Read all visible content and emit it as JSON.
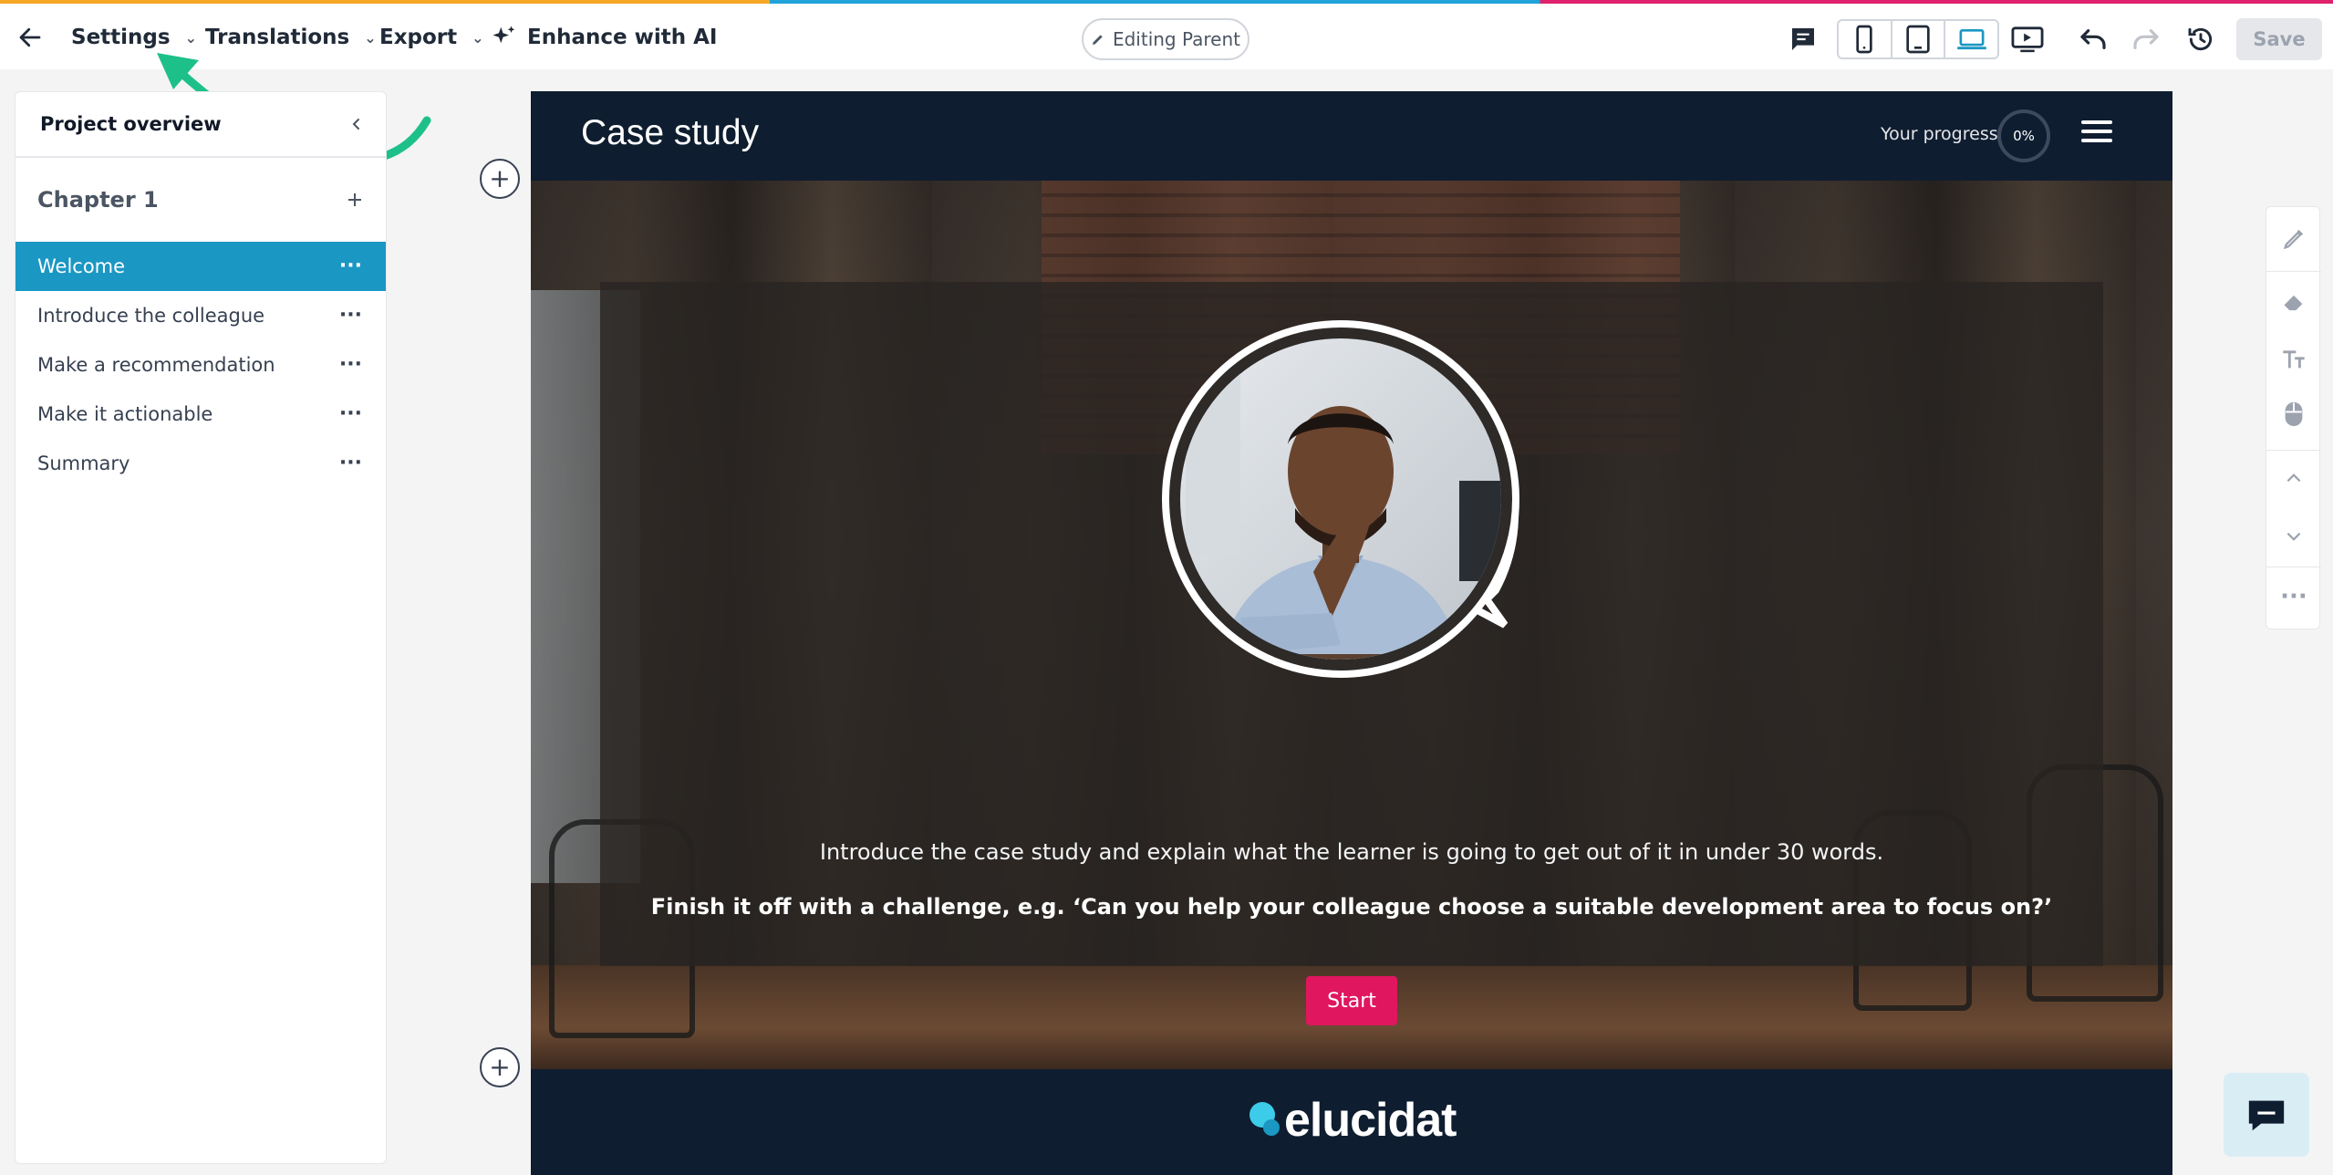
{
  "colors": {
    "accent": "#1b97c3",
    "start_button": "#e0165f",
    "header_bg": "#0f1d30",
    "annotation_arrow": "#1ec08a",
    "save_disabled": "#e5e7eb"
  },
  "toolbar": {
    "back_icon": "arrow-left-icon",
    "menus": [
      {
        "label": "Settings"
      },
      {
        "label": "Translations"
      },
      {
        "label": "Export"
      }
    ],
    "enhance_label": "Enhance with AI",
    "editing_label": "Editing Parent",
    "save_label": "Save",
    "icons": [
      "comment-icon",
      "phone-icon",
      "tablet-icon",
      "laptop-icon",
      "preview-icon",
      "undo-icon",
      "redo-icon",
      "history-icon"
    ],
    "active_device": "laptop"
  },
  "sidebar": {
    "title": "Project overview",
    "chapter": "Chapter 1",
    "pages": [
      {
        "label": "Welcome",
        "active": true
      },
      {
        "label": "Introduce the colleague",
        "active": false
      },
      {
        "label": "Make a recommendation",
        "active": false
      },
      {
        "label": "Make it actionable",
        "active": false
      },
      {
        "label": "Summary",
        "active": false
      }
    ]
  },
  "canvas": {
    "title": "Case study",
    "progress_label": "Your progress",
    "progress_value": "0%",
    "intro": "Introduce the case study and explain what the learner is going to get out of it in under 30 words.",
    "challenge": "Finish it off with a challenge, e.g. ‘Can you help your colleague choose a suitable development area to focus on?’",
    "start_label": "Start",
    "logo_text": "elucidat"
  },
  "rail_icons": [
    "brush-icon",
    "eraser-icon",
    "text-size-icon",
    "mouse-icon",
    "chevron-up-icon",
    "chevron-down-icon",
    "more-icon"
  ]
}
